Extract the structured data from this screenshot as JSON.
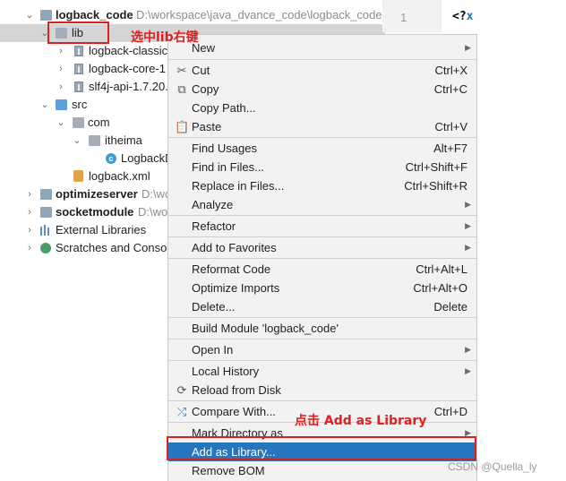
{
  "tree": {
    "items": [
      {
        "label": "logback_code",
        "path": "D:\\workspace\\java_dvance_code\\logback_code"
      },
      {
        "label": "lib"
      },
      {
        "label": "logback-classic-"
      },
      {
        "label": "logback-core-1"
      },
      {
        "label": "slf4j-api-1.7.20.j"
      },
      {
        "label": "src"
      },
      {
        "label": "com"
      },
      {
        "label": "itheima"
      },
      {
        "label": "LogbackD"
      },
      {
        "label": "logback.xml"
      },
      {
        "label": "optimizeserver",
        "path": "D:\\wo"
      },
      {
        "label": "socketmodule",
        "path": "D:\\wo"
      },
      {
        "label": "External Libraries"
      },
      {
        "label": "Scratches and Console"
      }
    ]
  },
  "editor": {
    "line_number": "1",
    "code_prefix": "<?",
    "code_tag": "x"
  },
  "menu": {
    "items": [
      {
        "label": "New",
        "shortcut": "",
        "arrow": true
      },
      {
        "label": "Cut",
        "shortcut": "Ctrl+X",
        "icon": "scissors-icon"
      },
      {
        "label": "Copy",
        "shortcut": "Ctrl+C",
        "icon": "copy-icon"
      },
      {
        "label": "Copy Path...",
        "shortcut": ""
      },
      {
        "label": "Paste",
        "shortcut": "Ctrl+V",
        "icon": "clipboard-icon"
      },
      {
        "label": "Find Usages",
        "shortcut": "Alt+F7"
      },
      {
        "label": "Find in Files...",
        "shortcut": "Ctrl+Shift+F"
      },
      {
        "label": "Replace in Files...",
        "shortcut": "Ctrl+Shift+R"
      },
      {
        "label": "Analyze",
        "shortcut": "",
        "arrow": true
      },
      {
        "label": "Refactor",
        "shortcut": "",
        "arrow": true
      },
      {
        "label": "Add to Favorites",
        "shortcut": "",
        "arrow": true
      },
      {
        "label": "Reformat Code",
        "shortcut": "Ctrl+Alt+L"
      },
      {
        "label": "Optimize Imports",
        "shortcut": "Ctrl+Alt+O"
      },
      {
        "label": "Delete...",
        "shortcut": "Delete"
      },
      {
        "label": "Build Module 'logback_code'",
        "shortcut": ""
      },
      {
        "label": "Open In",
        "shortcut": "",
        "arrow": true
      },
      {
        "label": "Local History",
        "shortcut": "",
        "arrow": true
      },
      {
        "label": "Reload from Disk",
        "shortcut": "",
        "icon": "reload-icon"
      },
      {
        "label": "Compare With...",
        "shortcut": "Ctrl+D",
        "icon": "compare-icon"
      },
      {
        "label": "Mark Directory as",
        "shortcut": "",
        "arrow": true
      },
      {
        "label": "Add as Library...",
        "shortcut": ""
      },
      {
        "label": "Remove BOM",
        "shortcut": ""
      }
    ]
  },
  "annotations": {
    "lib_note": "选中lib右键",
    "add_library_note": "点击 Add as Library"
  },
  "watermark": "CSDN @Quella_ly",
  "colors": {
    "highlight": "#2675bf",
    "annotation": "#e02020",
    "selected_row": "#d5d5d5"
  }
}
